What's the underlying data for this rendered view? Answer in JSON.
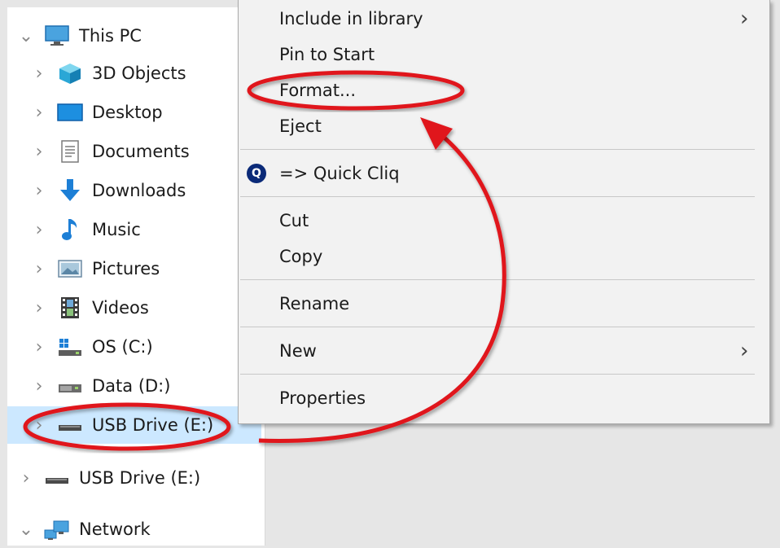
{
  "colors": {
    "background": "#e6e6e6",
    "selected_row": "#cce8ff",
    "annotation_red": "#e0161c",
    "menu_background": "#f2f2f2"
  },
  "navigation": {
    "items": [
      {
        "label": "This PC",
        "icon": "this-pc-icon",
        "expanded": true
      },
      {
        "label": "3D Objects",
        "icon": "3d-objects-icon"
      },
      {
        "label": "Desktop",
        "icon": "desktop-icon"
      },
      {
        "label": "Documents",
        "icon": "documents-icon"
      },
      {
        "label": "Downloads",
        "icon": "downloads-icon"
      },
      {
        "label": "Music",
        "icon": "music-icon"
      },
      {
        "label": "Pictures",
        "icon": "pictures-icon"
      },
      {
        "label": "Videos",
        "icon": "videos-icon"
      },
      {
        "label": "OS (C:)",
        "icon": "os-drive-icon"
      },
      {
        "label": "Data (D:)",
        "icon": "data-drive-icon"
      },
      {
        "label": "USB Drive (E:)",
        "icon": "usb-drive-icon",
        "selected": true
      },
      {
        "label": "USB Drive (E:)",
        "icon": "usb-drive-icon"
      },
      {
        "label": "Network",
        "icon": "network-icon",
        "expanded": true
      }
    ]
  },
  "context_menu": {
    "include_in_library": "Include in library",
    "pin_to_start": "Pin to Start",
    "format": "Format...",
    "eject": "Eject",
    "quick_cliq": "=> Quick Cliq",
    "quick_cliq_icon_letter": "Q",
    "cut": "Cut",
    "copy": "Copy",
    "rename": "Rename",
    "new": "New",
    "properties": "Properties",
    "submenu_arrow": "›"
  }
}
